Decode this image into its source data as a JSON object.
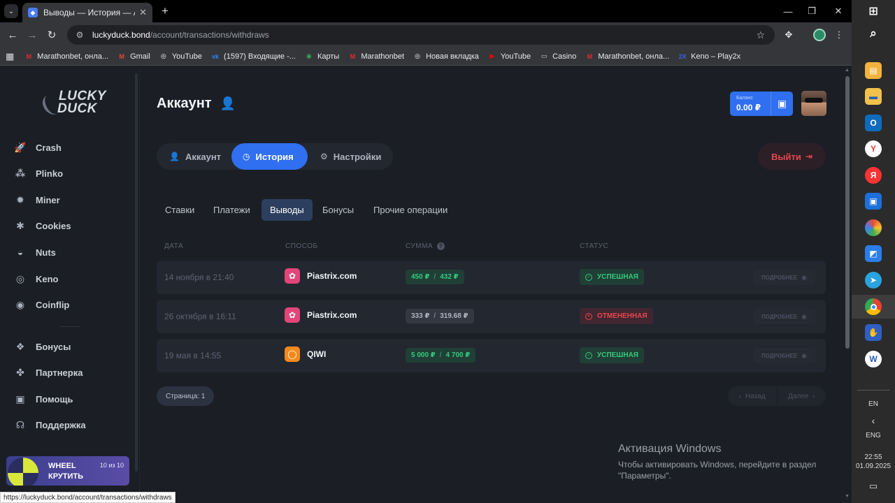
{
  "browser": {
    "tab_title": "Выводы — История — Аккаунт",
    "url_host": "luckyduck.bond",
    "url_path": "/account/transactions/withdraws",
    "status_url": "https://luckyduck.bond/account/transactions/withdraws",
    "bookmarks": [
      {
        "label": "Marathonbet, онла...",
        "icon": "marathonbet-icon",
        "color": "#e22b2b",
        "glyph": "M"
      },
      {
        "label": "Gmail",
        "icon": "gmail-icon",
        "color": "#ea4335",
        "glyph": "M"
      },
      {
        "label": "YouTube",
        "icon": "globe-icon",
        "color": "#ffffff",
        "glyph": "◎"
      },
      {
        "label": "(1597) Входящие -...",
        "icon": "vk-icon",
        "color": "#2787f5",
        "glyph": "vk"
      },
      {
        "label": "Карты",
        "icon": "maps-pin-icon",
        "color": "#34a853",
        "glyph": "◉"
      },
      {
        "label": "Marathonbet",
        "icon": "marathonbet-icon",
        "color": "#e22b2b",
        "glyph": "M"
      },
      {
        "label": "Новая вкладка",
        "icon": "globe-icon",
        "color": "#ffffff",
        "glyph": "◎"
      },
      {
        "label": "YouTube",
        "icon": "youtube-icon",
        "color": "#ff0000",
        "glyph": "▶"
      },
      {
        "label": "Casino",
        "icon": "folder-icon",
        "color": "#cfcfcf",
        "glyph": "▭"
      },
      {
        "label": "Marathonbet, онла...",
        "icon": "marathonbet-icon",
        "color": "#e22b2b",
        "glyph": "M"
      },
      {
        "label": "Keno – Play2x",
        "icon": "play2x-icon",
        "color": "#3a63e0",
        "glyph": "2X"
      }
    ]
  },
  "sidebar": {
    "logo_line1": "LUCKY",
    "logo_line2": "DUCK",
    "games": [
      {
        "label": "Crash",
        "icon": "rocket-icon",
        "glyph": "🚀"
      },
      {
        "label": "Plinko",
        "icon": "plinko-icon",
        "glyph": "⁂"
      },
      {
        "label": "Miner",
        "icon": "mine-icon",
        "glyph": "✹"
      },
      {
        "label": "Cookies",
        "icon": "gingerbread-icon",
        "glyph": "✱"
      },
      {
        "label": "Nuts",
        "icon": "acorn-icon",
        "glyph": "◒"
      },
      {
        "label": "Keno",
        "icon": "keno-icon",
        "glyph": "◎"
      },
      {
        "label": "Coinflip",
        "icon": "coin-icon",
        "glyph": "◉"
      }
    ],
    "extras": [
      {
        "label": "Бонусы",
        "icon": "gift-icon",
        "glyph": "❖"
      },
      {
        "label": "Партнерка",
        "icon": "partners-icon",
        "glyph": "✤"
      },
      {
        "label": "Помощь",
        "icon": "help-icon",
        "glyph": "▣"
      },
      {
        "label": "Поддержка",
        "icon": "headset-icon",
        "glyph": "☊"
      }
    ],
    "wheel": {
      "title": "WHEEL",
      "action": "КРУТИТЬ",
      "count": "10 из 10"
    }
  },
  "header": {
    "title": "Аккаунт",
    "balance_label": "Баланс",
    "balance_value": "0.00 ₽"
  },
  "account_tabs": [
    {
      "label": "Аккаунт",
      "icon": "user-icon",
      "glyph": "👤"
    },
    {
      "label": "История",
      "icon": "clock-icon",
      "glyph": "◷"
    },
    {
      "label": "Настройки",
      "icon": "gear-icon",
      "glyph": "⚙"
    }
  ],
  "logout_label": "Выйти",
  "history_tabs": [
    "Ставки",
    "Платежи",
    "Выводы",
    "Бонусы",
    "Прочие операции"
  ],
  "table": {
    "headers": {
      "date": "ДАТА",
      "method": "СПОСОБ",
      "amount": "СУММА",
      "status": "СТАТУС"
    },
    "rows": [
      {
        "date": "14 ноября в 21:40",
        "method": "Piastrix.com",
        "method_icon": "piastrix-icon",
        "method_color": "#e0467a",
        "amount_gross": "450 ₽",
        "amount_net": "432 ₽",
        "status": "УСПЕШНАЯ",
        "status_kind": "ok",
        "details": "ПОДРОБНЕЕ"
      },
      {
        "date": "26 октября в 16:11",
        "method": "Piastrix.com",
        "method_icon": "piastrix-icon",
        "method_color": "#e0467a",
        "amount_gross": "333 ₽",
        "amount_net": "319.68 ₽",
        "status": "ОТМЕНЕННАЯ",
        "status_kind": "no",
        "details": "ПОДРОБНЕЕ"
      },
      {
        "date": "19 мая в 14:55",
        "method": "QIWI",
        "method_icon": "qiwi-icon",
        "method_color": "#f28a1b",
        "amount_gross": "5 000 ₽",
        "amount_net": "4 700 ₽",
        "status": "УСПЕШНАЯ",
        "status_kind": "ok",
        "details": "ПОДРОБНЕЕ"
      }
    ]
  },
  "pagination": {
    "page_label": "Страница: 1",
    "prev": "Назад",
    "next": "Далее"
  },
  "watermark": {
    "title": "Активация Windows",
    "line1": "Чтобы активировать Windows, перейдите в раздел",
    "line2": "\"Параметры\"."
  },
  "taskbar": {
    "lang_top": "EN",
    "lang": "ENG",
    "time": "22:55",
    "date": "01.09.2025"
  },
  "colors": {
    "accent": "#2f6ff0",
    "success": "#36c97e",
    "danger": "#e7474f"
  }
}
